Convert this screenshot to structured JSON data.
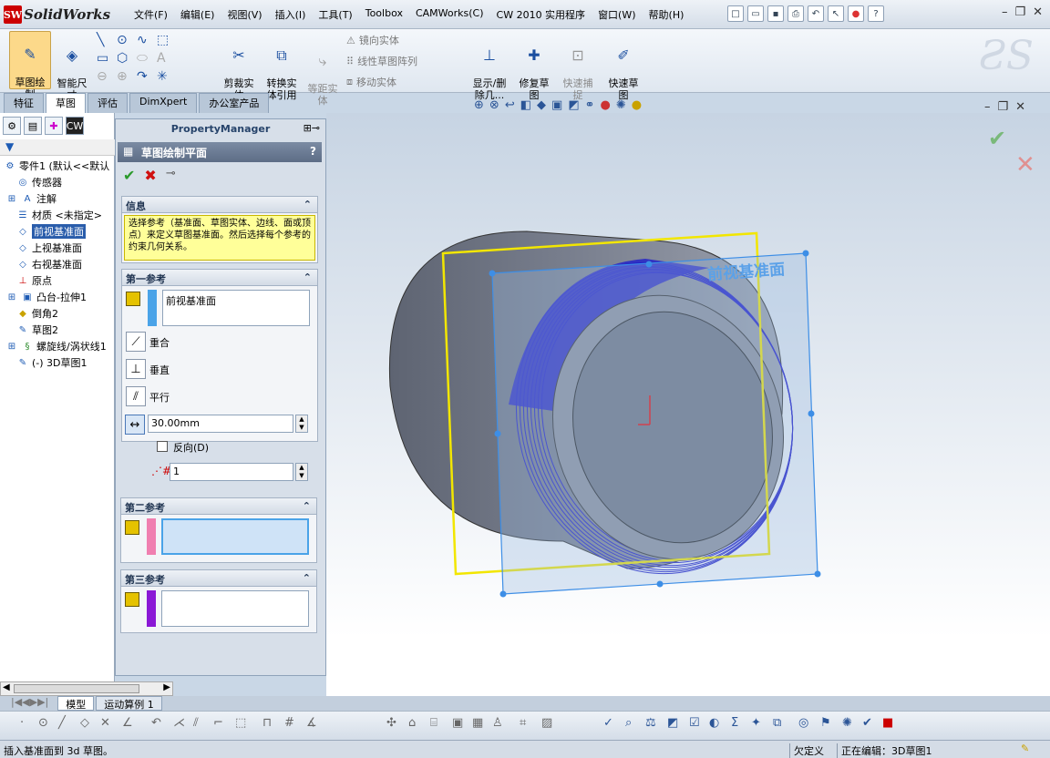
{
  "app": {
    "brand_short": "SW",
    "brand": "SolidWorks"
  },
  "menu": [
    "文件(F)",
    "编辑(E)",
    "视图(V)",
    "插入(I)",
    "工具(T)",
    "Toolbox",
    "CAMWorks(C)",
    "CW 2010 实用程序",
    "窗口(W)",
    "帮助(H)"
  ],
  "ribbon": {
    "sketch": "草图绘\n制",
    "smart_dim": "智能尺\n寸",
    "trim": "剪裁实\n体",
    "convert": "转换实\n体引用",
    "offset": "等距实\n体",
    "mirror": "镜向实体",
    "linear_pattern": "线性草图阵列",
    "move": "移动实体",
    "show_delete": "显示/删\n除几...",
    "repair": "修复草\n图",
    "quick_snaps": "快速捕\n捉",
    "rapid_sketch": "快速草\n图"
  },
  "tabs": [
    "特征",
    "草图",
    "评估",
    "DimXpert",
    "办公室产品"
  ],
  "active_tab": "草图",
  "tree": {
    "root": "零件1 (默认<<默认",
    "items": [
      "传感器",
      "注解",
      "材质 <未指定>",
      "前视基准面",
      "上视基准面",
      "右视基准面",
      "原点",
      "凸台-拉伸1",
      "倒角2",
      "草图2",
      "螺旋线/涡状线1",
      "(-) 3D草图1"
    ],
    "selected": "前视基准面"
  },
  "property_manager": {
    "header": "PropertyManager",
    "title": "草图绘制平面",
    "help": "?",
    "info_group": "信息",
    "info_text": "选择参考（基准面、草图实体、边线、面或顶点）来定义草图基准面。然后选择每个参考的约束几何关系。",
    "first_ref_group": "第一参考",
    "first_ref_value": "前视基准面",
    "coincident": "重合",
    "perpendicular": "垂直",
    "parallel": "平行",
    "distance": "30.00mm",
    "reverse": "反向(D)",
    "count": "1",
    "second_ref_group": "第二参考",
    "third_ref_group": "第三参考"
  },
  "viewport": {
    "plane_label": "前视基准面"
  },
  "bottom_tabs": [
    "模型",
    "运动算例 1"
  ],
  "status": {
    "left": "插入基准面到 3d 草图。",
    "defined": "欠定义",
    "editing": "正在编辑：3D草图1"
  },
  "colors": {
    "plane_yellow": "#f2e600",
    "plane_blue": "#3d8ee6",
    "helix": "#1f1fc8",
    "ref1": "#4aa3e8",
    "ref2": "#f07fb0",
    "ref3": "#8a18d6"
  }
}
